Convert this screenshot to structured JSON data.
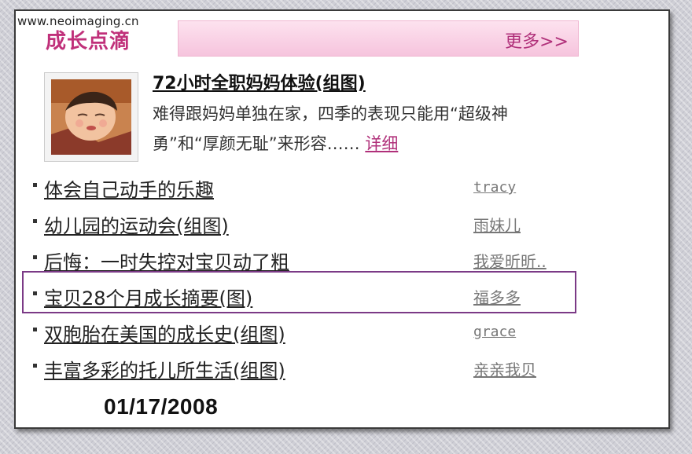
{
  "watermark": "www.neoimaging.cn",
  "header": {
    "title": "成长点滴",
    "more": "更多>>",
    "accent_color": "#c0307a",
    "bar_color": "#f6c4dd"
  },
  "feature": {
    "title": "72小时全职妈妈体验(组图)",
    "description": "难得跟妈妈单独在家，四季的表现只能用“超级神勇”和“厚颜无耻”来形容……",
    "detail_link": "详细"
  },
  "items": [
    {
      "title": "体会自己动手的乐趣",
      "author": "tracy"
    },
    {
      "title": "幼儿园的运动会(组图)",
      "author": "雨妹儿"
    },
    {
      "title": "后悔：一时失控对宝贝动了粗",
      "author": "我爱昕昕.."
    },
    {
      "title": "宝贝28个月成长摘要(图)",
      "author": "福多多"
    },
    {
      "title": "双胞胎在美国的成长史(组图)",
      "author": "grace"
    },
    {
      "title": "丰富多彩的托儿所生活(组图)",
      "author": "亲亲我贝"
    }
  ],
  "date": "01/17/2008",
  "highlight_color": "#7b3a86"
}
